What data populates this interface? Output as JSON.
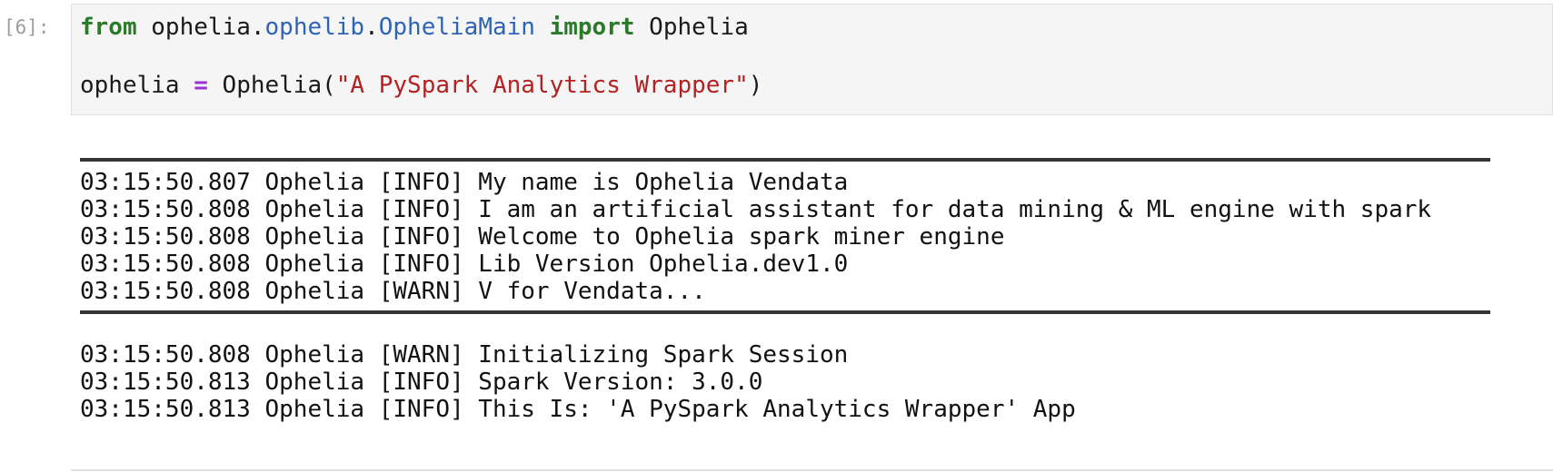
{
  "cell": {
    "prompt": "[6]:",
    "code": {
      "line1": {
        "kw_from": "from",
        "mod_pkg": " ophelia.",
        "mod_sub": "ophelib",
        "dot": ".",
        "mod_main": "OpheliaMain",
        "kw_import": "import",
        "name": " Ophelia"
      },
      "line2": {
        "var": "ophelia ",
        "op": "=",
        "call": " Ophelia(",
        "str": "\"A PySpark Analytics Wrapper\"",
        "close": ")"
      }
    }
  },
  "output": {
    "banner_lines": [
      "03:15:50.807 Ophelia [INFO] My name is Ophelia Vendata",
      "03:15:50.808 Ophelia [INFO] I am an artificial assistant for data mining & ML engine with spark",
      "03:15:50.808 Ophelia [INFO] Welcome to Ophelia spark miner engine",
      "03:15:50.808 Ophelia [INFO] Lib Version Ophelia.dev1.0",
      "03:15:50.808 Ophelia [WARN] V for Vendata..."
    ],
    "session_lines": [
      "03:15:50.808 Ophelia [WARN] Initializing Spark Session",
      "03:15:50.813 Ophelia [INFO] Spark Version: 3.0.0",
      "03:15:50.813 Ophelia [INFO] This Is: 'A PySpark Analytics Wrapper' App"
    ]
  },
  "colors": {
    "keyword": "#2a7a2a",
    "module": "#2f64b4",
    "operator": "#9b30d9",
    "string": "#b22222",
    "prompt": "#9e9e9e",
    "cell_bg": "#f5f5f5"
  }
}
